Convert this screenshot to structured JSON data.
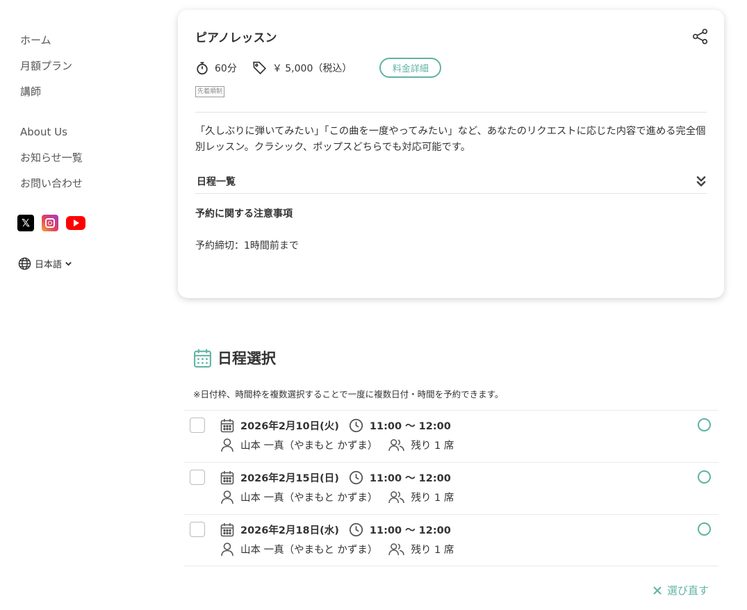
{
  "sidebar": {
    "nav_main": [
      {
        "label": "ホーム"
      },
      {
        "label": "月額プラン"
      },
      {
        "label": "講師"
      }
    ],
    "nav_sub": [
      {
        "label": "About Us"
      },
      {
        "label": "お知らせ一覧"
      },
      {
        "label": "お問い合わせ"
      }
    ],
    "social": [
      {
        "icon": "x-logo-icon"
      },
      {
        "icon": "instagram-icon"
      },
      {
        "icon": "youtube-icon"
      }
    ],
    "language": "日本語"
  },
  "lesson": {
    "title": "ピアノレッスン",
    "duration": "60分",
    "price": "￥ 5,000（税込）",
    "price_detail_button": "料金詳細",
    "badge": "先着順制",
    "description": "「久しぶりに弾いてみたい」「この曲を一度やってみたい」など、あなたのリクエストに応じた内容で進める完全個別レッスン。クラシック、ポップスどちらでも対応可能です。",
    "schedule_list_label": "日程一覧",
    "notes_heading": "予約に関する注意事項",
    "notes_body": "予約締切：1時間前まで"
  },
  "schedule": {
    "title": "日程選択",
    "note": "※日付枠、時間枠を複数選択することで一度に複数日付・時間を予約できます。",
    "slots": [
      {
        "date": "2026年2月10日(火)",
        "time": "11:00 〜 12:00",
        "teacher": "山本 一真（やまもと かずま）",
        "remaining": "残り 1 席"
      },
      {
        "date": "2026年2月15日(日)",
        "time": "11:00 〜 12:00",
        "teacher": "山本 一真（やまもと かずま）",
        "remaining": "残り 1 席"
      },
      {
        "date": "2026年2月18日(水)",
        "time": "11:00 〜 12:00",
        "teacher": "山本 一真（やまもと かずま）",
        "remaining": "残り 1 席"
      }
    ],
    "reset_label": "選び直す"
  },
  "colors": {
    "accent": "#5fb3a3",
    "text": "#333333"
  }
}
